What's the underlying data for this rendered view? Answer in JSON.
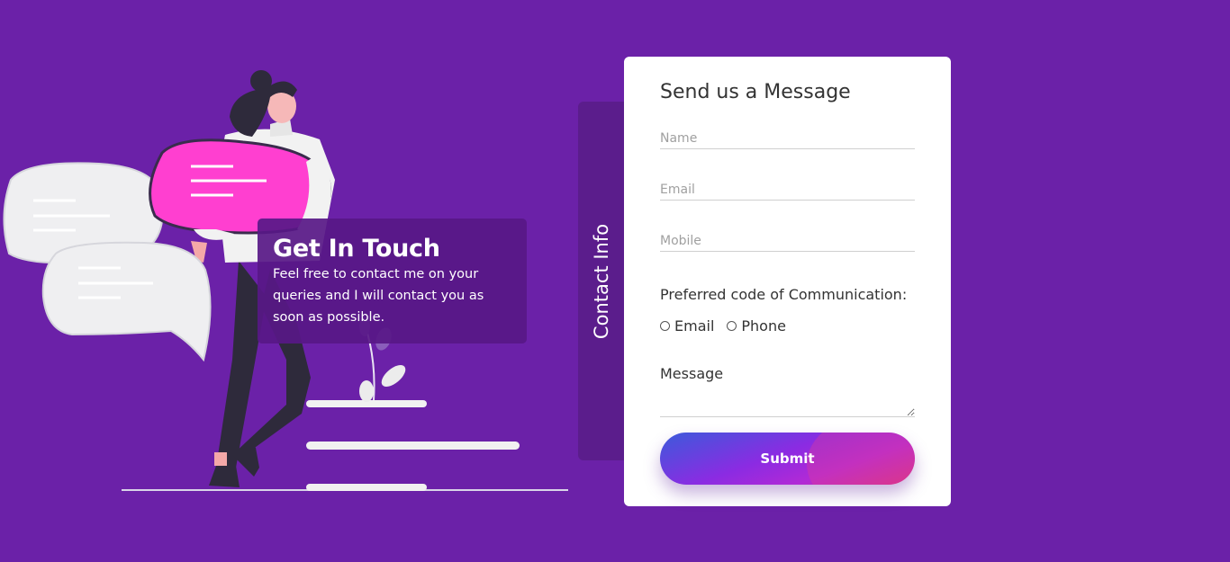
{
  "info": {
    "title": "Get In Touch",
    "text": "Feel free to contact me on your queries and I will contact you as soon as possible."
  },
  "contact_tab": {
    "label": "Contact Info"
  },
  "form": {
    "heading": "Send us a Message",
    "name_placeholder": "Name",
    "email_placeholder": "Email",
    "mobile_placeholder": "Mobile",
    "preference_label": "Preferred code of Communication:",
    "radio_options": [
      "Email",
      "Phone"
    ],
    "message_label": "Message",
    "submit_label": "Submit"
  },
  "colors": {
    "background": "#6b21a8",
    "tab": "#5b1d8c",
    "card": "#ffffff",
    "accent_pink": "#ff3fd0",
    "button_start": "#3b5bdb",
    "button_end": "#d63384"
  },
  "icons": {
    "illustration": "woman-with-chat-bubbles-illustration"
  }
}
